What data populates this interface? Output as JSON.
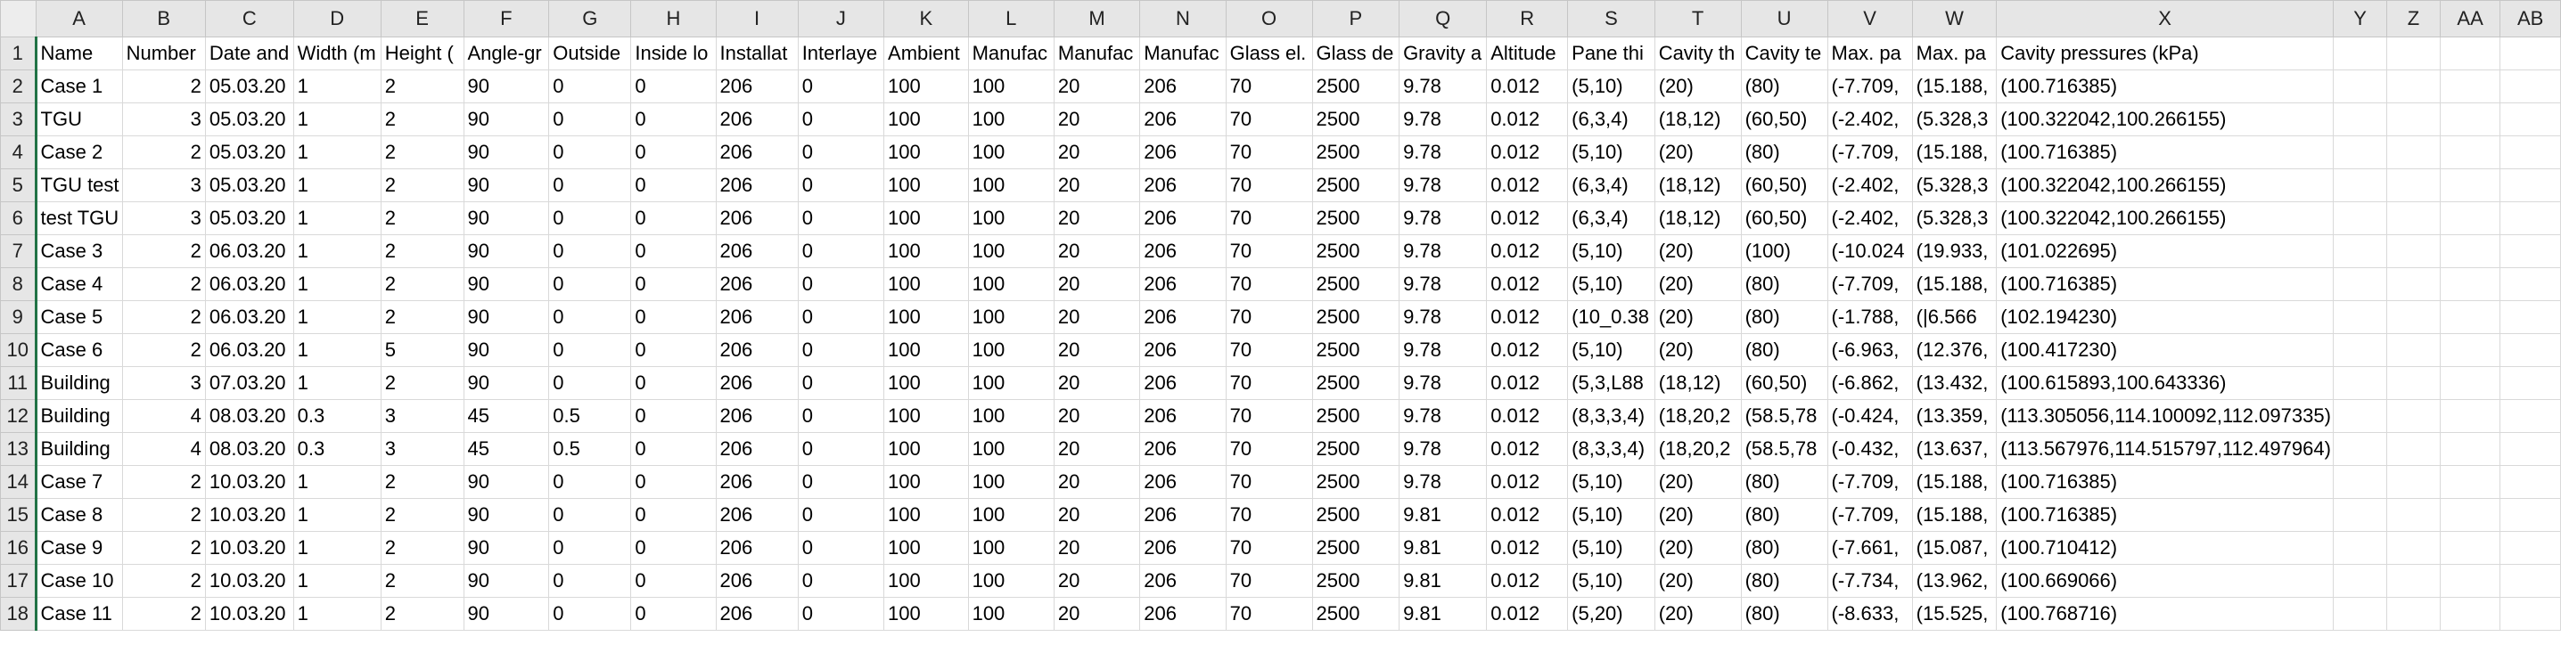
{
  "accent_color": "#217346",
  "columns": [
    "A",
    "B",
    "C",
    "D",
    "E",
    "F",
    "G",
    "H",
    "I",
    "J",
    "K",
    "L",
    "M",
    "N",
    "O",
    "P",
    "Q",
    "R",
    "S",
    "T",
    "U",
    "V",
    "W",
    "X",
    "Y",
    "Z",
    "AA",
    "AB"
  ],
  "rows": [
    [
      "Name",
      "Number",
      "Date and",
      "Width (m",
      "Height (",
      "Angle-gr",
      "Outside",
      "Inside lo",
      "Installat",
      "Interlaye",
      "Ambient",
      "Manufac",
      "Manufac",
      "Manufac",
      "Glass el.",
      "Glass de",
      "Gravity a",
      "Altitude",
      "Pane thi",
      "Cavity th",
      "Cavity te",
      "Max. pa",
      "Max. pa",
      "Cavity pressures (kPa)",
      "",
      "",
      "",
      ""
    ],
    [
      "Case 1",
      "2",
      "05.03.20",
      "1",
      "2",
      "90",
      "0",
      "0",
      "206",
      "0",
      "100",
      "100",
      "20",
      "206",
      "70",
      "2500",
      "9.78",
      "0.012",
      "(5,10)",
      "(20)",
      "(80)",
      "(-7.709,",
      "(15.188,",
      "(100.716385)",
      "",
      "",
      "",
      ""
    ],
    [
      "TGU",
      "3",
      "05.03.20",
      "1",
      "2",
      "90",
      "0",
      "0",
      "206",
      "0",
      "100",
      "100",
      "20",
      "206",
      "70",
      "2500",
      "9.78",
      "0.012",
      "(6,3,4)",
      "(18,12)",
      "(60,50)",
      "(-2.402,",
      "(5.328,3",
      "(100.322042,100.266155)",
      "",
      "",
      "",
      ""
    ],
    [
      "Case 2",
      "2",
      "05.03.20",
      "1",
      "2",
      "90",
      "0",
      "0",
      "206",
      "0",
      "100",
      "100",
      "20",
      "206",
      "70",
      "2500",
      "9.78",
      "0.012",
      "(5,10)",
      "(20)",
      "(80)",
      "(-7.709,",
      "(15.188,",
      "(100.716385)",
      "",
      "",
      "",
      ""
    ],
    [
      "TGU test",
      "3",
      "05.03.20",
      "1",
      "2",
      "90",
      "0",
      "0",
      "206",
      "0",
      "100",
      "100",
      "20",
      "206",
      "70",
      "2500",
      "9.78",
      "0.012",
      "(6,3,4)",
      "(18,12)",
      "(60,50)",
      "(-2.402,",
      "(5.328,3",
      "(100.322042,100.266155)",
      "",
      "",
      "",
      ""
    ],
    [
      "test TGU",
      "3",
      "05.03.20",
      "1",
      "2",
      "90",
      "0",
      "0",
      "206",
      "0",
      "100",
      "100",
      "20",
      "206",
      "70",
      "2500",
      "9.78",
      "0.012",
      "(6,3,4)",
      "(18,12)",
      "(60,50)",
      "(-2.402,",
      "(5.328,3",
      "(100.322042,100.266155)",
      "",
      "",
      "",
      ""
    ],
    [
      "Case 3",
      "2",
      "06.03.20",
      "1",
      "2",
      "90",
      "0",
      "0",
      "206",
      "0",
      "100",
      "100",
      "20",
      "206",
      "70",
      "2500",
      "9.78",
      "0.012",
      "(5,10)",
      "(20)",
      "(100)",
      "(-10.024",
      "(19.933,",
      "(101.022695)",
      "",
      "",
      "",
      ""
    ],
    [
      "Case 4",
      "2",
      "06.03.20",
      "1",
      "2",
      "90",
      "0",
      "0",
      "206",
      "0",
      "100",
      "100",
      "20",
      "206",
      "70",
      "2500",
      "9.78",
      "0.012",
      "(5,10)",
      "(20)",
      "(80)",
      "(-7.709,",
      "(15.188,",
      "(100.716385)",
      "",
      "",
      "",
      ""
    ],
    [
      "Case 5",
      "2",
      "06.03.20",
      "1",
      "2",
      "90",
      "0",
      "0",
      "206",
      "0",
      "100",
      "100",
      "20",
      "206",
      "70",
      "2500",
      "9.78",
      "0.012",
      "(10_0.38",
      "(20)",
      "(80)",
      "(-1.788,",
      "(|6.566",
      "(102.194230)",
      "",
      "",
      "",
      ""
    ],
    [
      "Case 6",
      "2",
      "06.03.20",
      "1",
      "5",
      "90",
      "0",
      "0",
      "206",
      "0",
      "100",
      "100",
      "20",
      "206",
      "70",
      "2500",
      "9.78",
      "0.012",
      "(5,10)",
      "(20)",
      "(80)",
      "(-6.963,",
      "(12.376,",
      "(100.417230)",
      "",
      "",
      "",
      ""
    ],
    [
      "Building",
      "3",
      "07.03.20",
      "1",
      "2",
      "90",
      "0",
      "0",
      "206",
      "0",
      "100",
      "100",
      "20",
      "206",
      "70",
      "2500",
      "9.78",
      "0.012",
      "(5,3,L88",
      "(18,12)",
      "(60,50)",
      "(-6.862,",
      "(13.432,",
      "(100.615893,100.643336)",
      "",
      "",
      "",
      ""
    ],
    [
      "Building",
      "4",
      "08.03.20",
      "0.3",
      "3",
      "45",
      "0.5",
      "0",
      "206",
      "0",
      "100",
      "100",
      "20",
      "206",
      "70",
      "2500",
      "9.78",
      "0.012",
      "(8,3,3,4)",
      "(18,20,2",
      "(58.5,78",
      "(-0.424,",
      "(13.359,",
      "(113.305056,114.100092,112.097335)",
      "",
      "",
      "",
      ""
    ],
    [
      "Building",
      "4",
      "08.03.20",
      "0.3",
      "3",
      "45",
      "0.5",
      "0",
      "206",
      "0",
      "100",
      "100",
      "20",
      "206",
      "70",
      "2500",
      "9.78",
      "0.012",
      "(8,3,3,4)",
      "(18,20,2",
      "(58.5,78",
      "(-0.432,",
      "(13.637,",
      "(113.567976,114.515797,112.497964)",
      "",
      "",
      "",
      ""
    ],
    [
      "Case 7",
      "2",
      "10.03.20",
      "1",
      "2",
      "90",
      "0",
      "0",
      "206",
      "0",
      "100",
      "100",
      "20",
      "206",
      "70",
      "2500",
      "9.78",
      "0.012",
      "(5,10)",
      "(20)",
      "(80)",
      "(-7.709,",
      "(15.188,",
      "(100.716385)",
      "",
      "",
      "",
      ""
    ],
    [
      "Case 8",
      "2",
      "10.03.20",
      "1",
      "2",
      "90",
      "0",
      "0",
      "206",
      "0",
      "100",
      "100",
      "20",
      "206",
      "70",
      "2500",
      "9.81",
      "0.012",
      "(5,10)",
      "(20)",
      "(80)",
      "(-7.709,",
      "(15.188,",
      "(100.716385)",
      "",
      "",
      "",
      ""
    ],
    [
      "Case 9",
      "2",
      "10.03.20",
      "1",
      "2",
      "90",
      "0",
      "0",
      "206",
      "0",
      "100",
      "100",
      "20",
      "206",
      "70",
      "2500",
      "9.81",
      "0.012",
      "(5,10)",
      "(20)",
      "(80)",
      "(-7.661,",
      "(15.087,",
      "(100.710412)",
      "",
      "",
      "",
      ""
    ],
    [
      "Case 10",
      "2",
      "10.03.20",
      "1",
      "2",
      "90",
      "0",
      "0",
      "206",
      "0",
      "100",
      "100",
      "20",
      "206",
      "70",
      "2500",
      "9.81",
      "0.012",
      "(5,10)",
      "(20)",
      "(80)",
      "(-7.734,",
      "(13.962,",
      "(100.669066)",
      "",
      "",
      "",
      ""
    ],
    [
      "Case 11",
      "2",
      "10.03.20",
      "1",
      "2",
      "90",
      "0",
      "0",
      "206",
      "0",
      "100",
      "100",
      "20",
      "206",
      "70",
      "2500",
      "9.81",
      "0.012",
      "(5,20)",
      "(20)",
      "(80)",
      "(-8.633,",
      "(15.525,",
      "(100.768716)",
      "",
      "",
      "",
      ""
    ]
  ]
}
